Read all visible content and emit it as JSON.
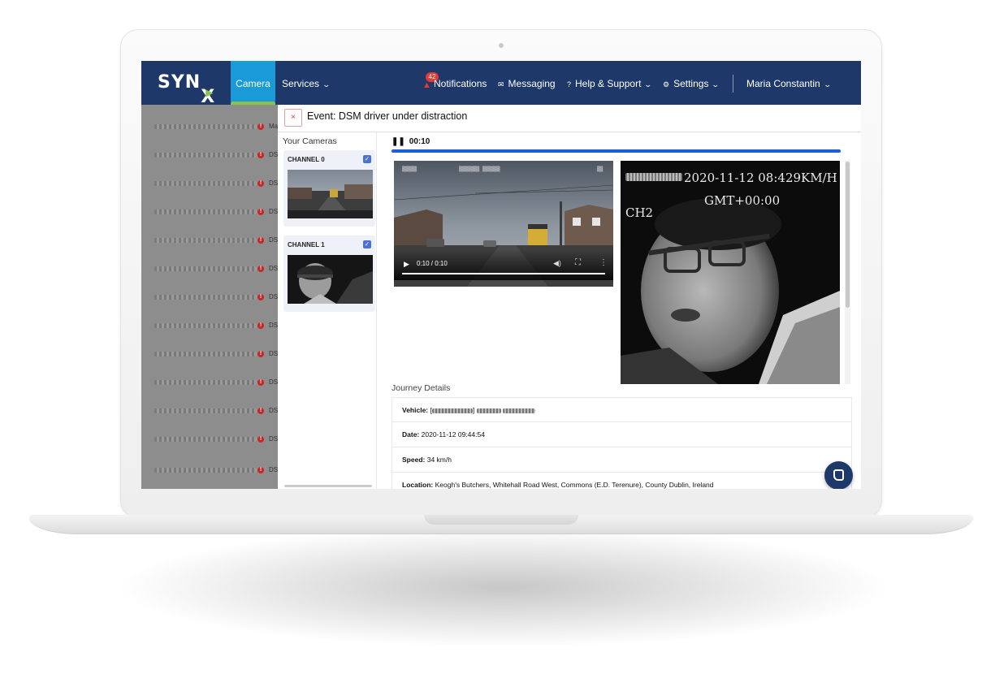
{
  "nav": {
    "logo": "SYN",
    "tabs": [
      {
        "label": "Camera",
        "active": true
      },
      {
        "label": "Services"
      }
    ],
    "notifications_count": "42",
    "notifications_label": "Notifications",
    "messaging_label": "Messaging",
    "help_label": "Help & Support",
    "settings_label": "Settings",
    "user_name": "Maria Constantin"
  },
  "left_list": {
    "rows": [
      {
        "text": "Ma"
      },
      {
        "text": "DS"
      },
      {
        "text": "DS"
      },
      {
        "text": "DS"
      },
      {
        "text": "DS"
      },
      {
        "text": "DS"
      },
      {
        "text": "DS"
      },
      {
        "text": "DS"
      },
      {
        "text": "DS"
      },
      {
        "text": "DS"
      },
      {
        "text": "DS"
      },
      {
        "text": "DS"
      },
      {
        "text": "DS"
      }
    ]
  },
  "event": {
    "close_label": "×",
    "title": "Event: DSM driver under distraction"
  },
  "cameras": {
    "title": "Your Cameras",
    "items": [
      {
        "label": "CHANNEL 0",
        "checked": true
      },
      {
        "label": "CHANNEL 1",
        "checked": true
      }
    ]
  },
  "player": {
    "elapsed": "00:10",
    "video1_time": "0:10 / 0:10",
    "ch2_timestamp": "2020-11-12 08:4",
    "ch2_speed": "29KM/H",
    "ch2_timezone": "GMT+00:00",
    "ch2_channel": "CH2"
  },
  "journey": {
    "title": "Journey Details",
    "vehicle_label": "Vehicle:",
    "date_label": "Date:",
    "date_value": "2020-11-12 09:44:54",
    "speed_label": "Speed:",
    "speed_value": "34 km/h",
    "location_label": "Location:",
    "location_value": "Keogh's Butchers, Whitehall Road West, Commons (E.D. Terenure), County Dublin, Ireland"
  },
  "colors": {
    "nav_bg": "#1d3869",
    "active_tab": "#1a9ad6",
    "accent_green": "#8bc34a",
    "progress": "#1a5fd6",
    "alert_red": "#e53935"
  }
}
